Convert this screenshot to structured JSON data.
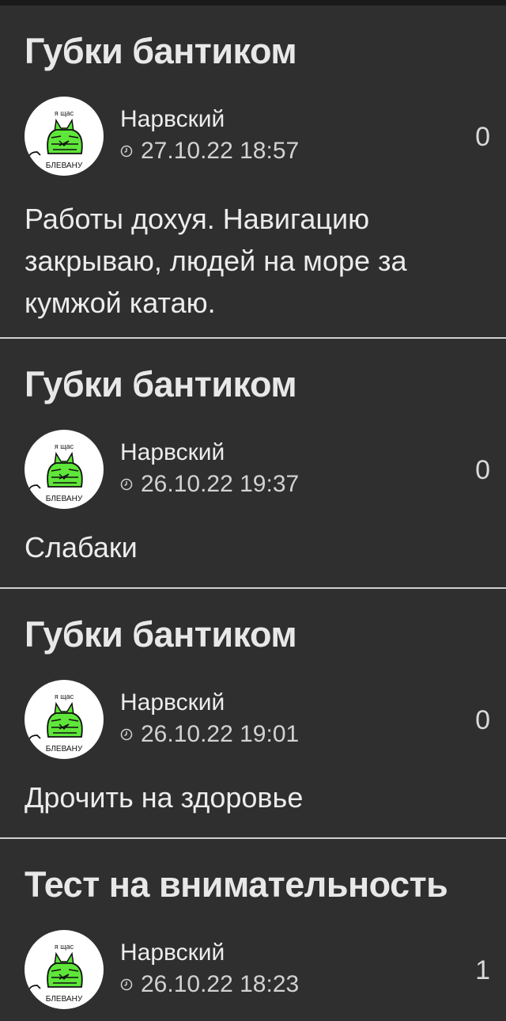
{
  "posts": [
    {
      "title": "Губки бантиком",
      "author": "Нарвский",
      "datetime": "27.10.22 18:57",
      "score": "0",
      "text": "Работы дохуя. Навигацию закрываю, людей на море за кумжой катаю.",
      "avatar": {
        "top_text": "я щас",
        "bottom_text": "БЛЕВАНУ"
      }
    },
    {
      "title": "Губки бантиком",
      "author": "Нарвский",
      "datetime": "26.10.22 19:37",
      "score": "0",
      "text": "Слабаки",
      "avatar": {
        "top_text": "я щас",
        "bottom_text": "БЛЕВАНУ"
      }
    },
    {
      "title": "Губки бантиком",
      "author": "Нарвский",
      "datetime": "26.10.22 19:01",
      "score": "0",
      "text": "Дрочить на здоровье",
      "avatar": {
        "top_text": "я щас",
        "bottom_text": "БЛЕВАНУ"
      }
    },
    {
      "title": "Тест на внимательность",
      "author": "Нарвский",
      "datetime": "26.10.22 18:23",
      "score": "1",
      "text": "",
      "avatar": {
        "top_text": "я щас",
        "bottom_text": "БЛЕВАНУ"
      }
    }
  ],
  "icons": {
    "clock": "clock-icon",
    "avatar": "green-cat-avatar"
  },
  "colors": {
    "background": "#2f2f2f",
    "divider": "#cfcfcf",
    "text": "#ececec",
    "avatar_green": "#5fe63a"
  }
}
